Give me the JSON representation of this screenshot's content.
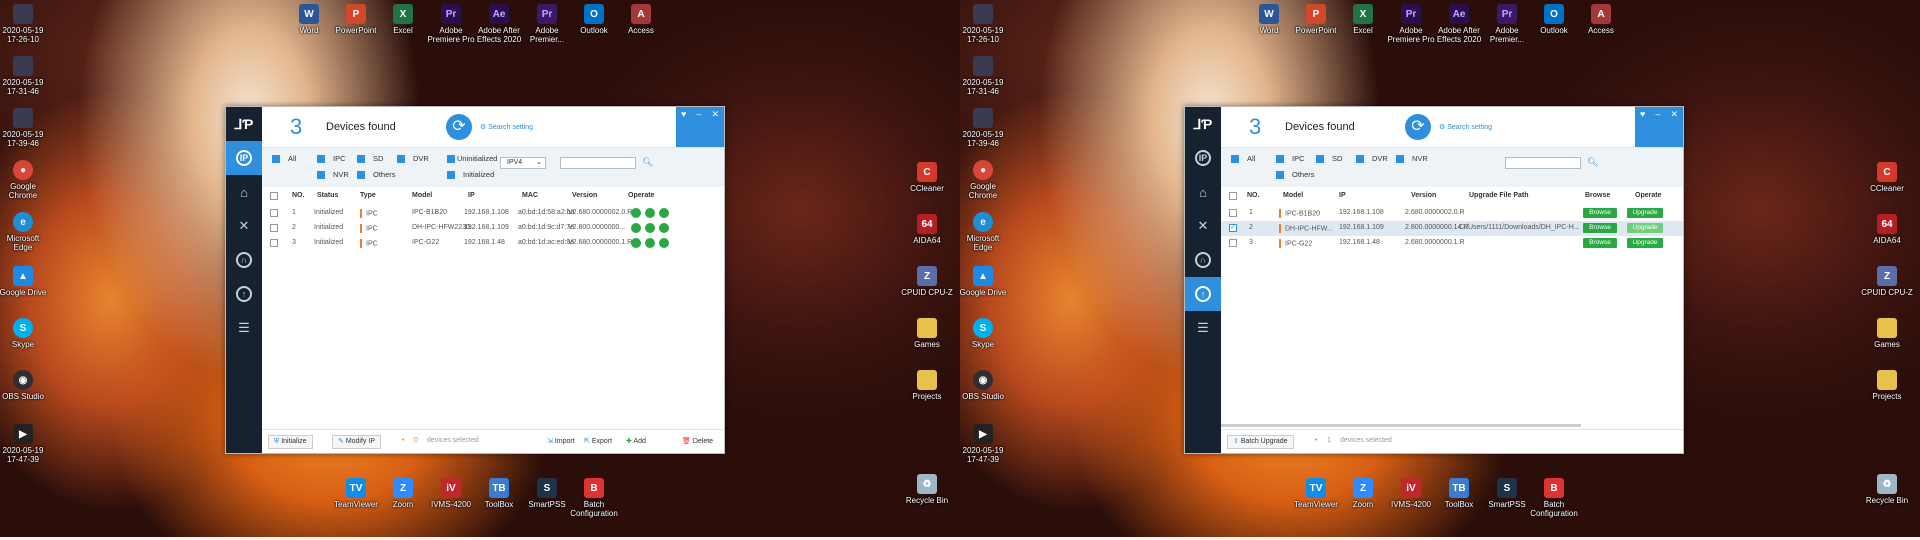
{
  "desktop": {
    "left_icons": [
      {
        "label": "2020-05-19\n17-26-10",
        "icon": "video-file-icon",
        "color": "#3a3a52"
      },
      {
        "label": "2020-05-19\n17-31-46",
        "icon": "video-file-icon",
        "color": "#3a3a52"
      },
      {
        "label": "2020-05-19\n17-39-46",
        "icon": "video-file-icon",
        "color": "#3a3a52"
      },
      {
        "label": "Google\nChrome",
        "icon": "chrome-icon",
        "color": "#db4437"
      },
      {
        "label": "Microsoft\nEdge",
        "icon": "edge-icon",
        "color": "#1e8fd6"
      },
      {
        "label": "Google Drive",
        "icon": "drive-icon",
        "color": "#1e88e5"
      },
      {
        "label": "Skype",
        "icon": "skype-icon",
        "color": "#00aff0"
      },
      {
        "label": "OBS Studio",
        "icon": "obs-icon",
        "color": "#302e31"
      },
      {
        "label": "2020-05-19\n17-47-39",
        "icon": "video-file-icon",
        "color": "#222"
      }
    ],
    "top_icons": [
      {
        "label": "Word",
        "icon": "word-icon",
        "color": "#2b579a",
        "glyph": "W"
      },
      {
        "label": "PowerPoint",
        "icon": "powerpoint-icon",
        "color": "#d24726",
        "glyph": "P"
      },
      {
        "label": "Excel",
        "icon": "excel-icon",
        "color": "#217346",
        "glyph": "X"
      },
      {
        "label": "Adobe\nPremiere Pro",
        "icon": "premiere-icon",
        "color": "#2a0f4e",
        "glyph": "Pr"
      },
      {
        "label": "Adobe After\nEffects 2020",
        "icon": "after-effects-icon",
        "color": "#2a0f4e",
        "glyph": "Ae"
      },
      {
        "label": "Adobe\nPremier...",
        "icon": "premiere-rush-icon",
        "color": "#3a1a68",
        "glyph": "Pr"
      },
      {
        "label": "Outlook",
        "icon": "outlook-icon",
        "color": "#0072c6",
        "glyph": "O"
      },
      {
        "label": "Access",
        "icon": "access-icon",
        "color": "#a4373a",
        "glyph": "A"
      }
    ],
    "bottom_icons": [
      {
        "label": "TeamViewer",
        "icon": "teamviewer-icon",
        "color": "#0e8ee9",
        "glyph": "TV"
      },
      {
        "label": "Zoom",
        "icon": "zoom-icon",
        "color": "#2d8cff",
        "glyph": "Z"
      },
      {
        "label": "IVMS-4200",
        "icon": "ivms-icon",
        "color": "#c0282d",
        "glyph": "iV"
      },
      {
        "label": "ToolBox",
        "icon": "toolbox-icon",
        "color": "#3a7bd5",
        "glyph": "TB"
      },
      {
        "label": "SmartPSS",
        "icon": "smartpss-icon",
        "color": "#1e3248",
        "glyph": "S"
      },
      {
        "label": "Batch\nConfiguration",
        "icon": "batch-config-icon",
        "color": "#d33",
        "glyph": "B"
      }
    ],
    "right_icons": [
      {
        "label": "CCleaner",
        "icon": "ccleaner-icon",
        "color": "#d43a2a",
        "glyph": "C"
      },
      {
        "label": "AIDA64",
        "icon": "aida64-icon",
        "color": "#b51e23",
        "glyph": "64"
      },
      {
        "label": "CPUID CPU-Z",
        "icon": "cpuz-icon",
        "color": "#5a6fa8",
        "glyph": "Z"
      },
      {
        "label": "Games",
        "icon": "folder-icon",
        "color": "#e8c04a",
        "glyph": ""
      },
      {
        "label": "Projects",
        "icon": "folder-icon",
        "color": "#e8c04a",
        "glyph": ""
      },
      {
        "label": "Recycle Bin",
        "icon": "recycle-bin-icon",
        "color": "#9fb6c8",
        "glyph": ""
      }
    ]
  },
  "left_window": {
    "count": "3",
    "title": "Devices found",
    "search_setting": "Search setting",
    "filters": {
      "all": "All",
      "ipc": "IPC",
      "sd": "SD",
      "dvr": "DVR",
      "nvr": "NVR",
      "others": "Others",
      "uninitialized": "Uninitialized",
      "initialized": "Initialized",
      "protocol": "IPV4"
    },
    "columns": {
      "no": "NO.",
      "status": "Status",
      "type": "Type",
      "model": "Model",
      "ip": "IP",
      "mac": "MAC",
      "version": "Version",
      "operate": "Operate"
    },
    "rows": [
      {
        "no": "1",
        "status": "Initialized",
        "type": "IPC",
        "model": "IPC-B1B20",
        "ip": "192.168.1.108",
        "mac": "a0:bd:1d:58:a2:ba",
        "version": "V2.680.0000002.0.R"
      },
      {
        "no": "2",
        "status": "Initialized",
        "type": "IPC",
        "model": "DH-IPC-HFW2230...",
        "ip": "192.168.1.109",
        "mac": "a0:bd:1d:9c:d7:7e",
        "version": "V2.800.0000000..."
      },
      {
        "no": "3",
        "status": "Initialized",
        "type": "IPC",
        "model": "IPC-G22",
        "ip": "192.168.1.48",
        "mac": "a0:bd:1d:ac:ed:9a",
        "version": "V2.680.0000000.1.R"
      }
    ],
    "bottom": {
      "initialize": "Initialize",
      "modify_ip": "Modify IP",
      "count": "0",
      "selected": "devices selected",
      "import": "Import",
      "export": "Export",
      "add": "Add",
      "delete": "Delete"
    }
  },
  "right_window": {
    "count": "3",
    "title": "Devices found",
    "search_setting": "Search setting",
    "filters": {
      "all": "All",
      "ipc": "IPC",
      "sd": "SD",
      "dvr": "DVR",
      "nvr": "NVR",
      "others": "Others"
    },
    "columns": {
      "no": "NO.",
      "model": "Model",
      "ip": "IP",
      "version": "Version",
      "path": "Upgrade File Path",
      "browse": "Browse",
      "operate": "Operate"
    },
    "rows": [
      {
        "no": "1",
        "model": "IPC-B1B20",
        "ip": "192.168.1.108",
        "version": "2.680.0000002.0.R",
        "path": "",
        "checked": false
      },
      {
        "no": "2",
        "model": "DH-IPC-HFW...",
        "ip": "192.168.1.109",
        "version": "2.800.0000000.14.R",
        "path": "C:/Users/1111/Downloads/DH_IPC-H...",
        "checked": true
      },
      {
        "no": "3",
        "model": "IPC-G22",
        "ip": "192.168.1.48",
        "version": "2.680.0000000.1.R",
        "path": "",
        "checked": false
      }
    ],
    "browse_label": "Browse",
    "upgrade_label": "Upgrade",
    "bottom": {
      "batch_upgrade": "Batch Upgrade",
      "count": "1",
      "selected": "devices selected"
    }
  }
}
